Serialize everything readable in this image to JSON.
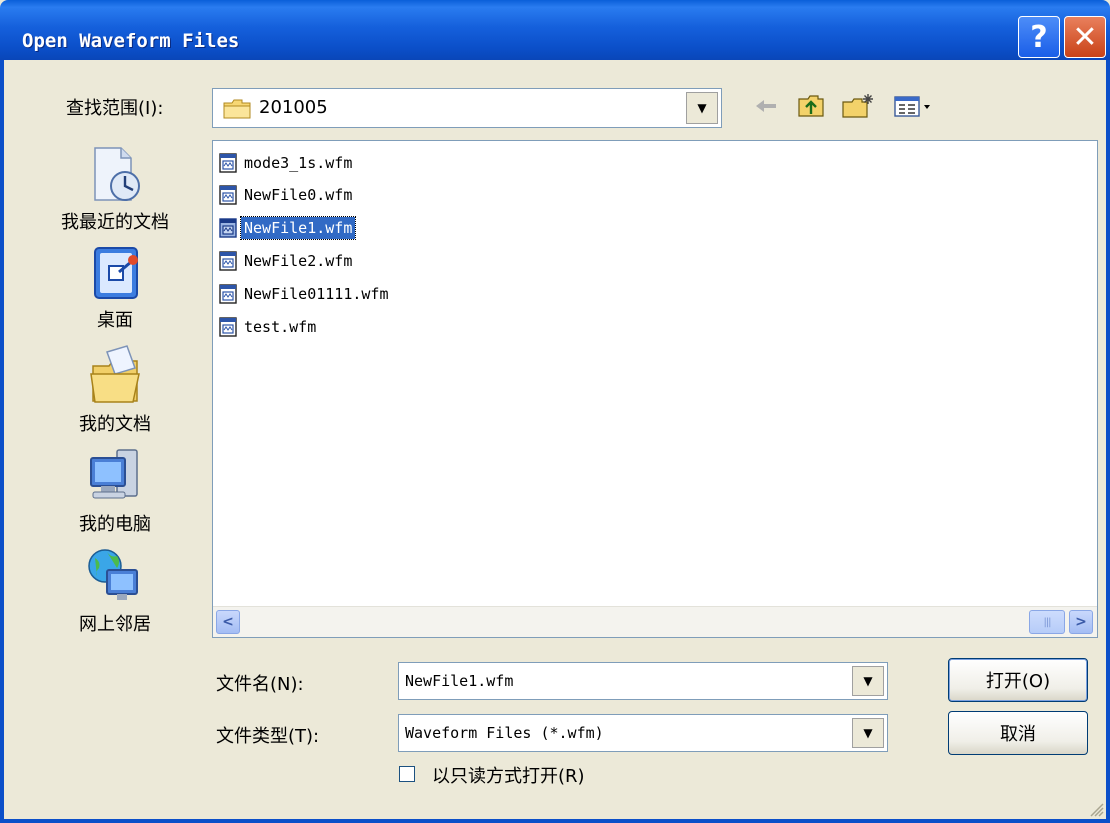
{
  "window": {
    "title": "Open Waveform Files",
    "help_glyph": "?",
    "close_glyph": "✕"
  },
  "lookin": {
    "label": "查找范围(I):",
    "value": "201005",
    "dropdown_glyph": "▼"
  },
  "toolbar": {
    "back_icon": "back-arrow-icon",
    "up_icon": "up-folder-icon",
    "new_folder_icon": "new-folder-icon",
    "view_icon": "view-menu-icon"
  },
  "places": [
    {
      "label": "我最近的文档",
      "icon": "recent-documents-icon"
    },
    {
      "label": "桌面",
      "icon": "desktop-icon"
    },
    {
      "label": "我的文档",
      "icon": "my-documents-icon"
    },
    {
      "label": "我的电脑",
      "icon": "my-computer-icon"
    },
    {
      "label": "网上邻居",
      "icon": "network-places-icon"
    }
  ],
  "files": [
    {
      "name": "mode3_1s.wfm",
      "selected": false
    },
    {
      "name": "NewFile0.wfm",
      "selected": false
    },
    {
      "name": "NewFile1.wfm",
      "selected": true
    },
    {
      "name": "NewFile2.wfm",
      "selected": false
    },
    {
      "name": "NewFile01111.wfm",
      "selected": false
    },
    {
      "name": "test.wfm",
      "selected": false
    }
  ],
  "scroll": {
    "left_glyph": "<",
    "right_glyph": ">",
    "thumb_glyph": "|||"
  },
  "filename": {
    "label": "文件名(N):",
    "value": "NewFile1.wfm"
  },
  "filetype": {
    "label": "文件类型(T):",
    "value": "Waveform Files (*.wfm)"
  },
  "readonly": {
    "label": "以只读方式打开(R)",
    "checked": false
  },
  "buttons": {
    "open": "打开(O)",
    "cancel": "取消"
  },
  "colors": {
    "titlebar": "#0b4fc9",
    "selection": "#316ac5",
    "dialog_bg": "#ece9d8"
  }
}
